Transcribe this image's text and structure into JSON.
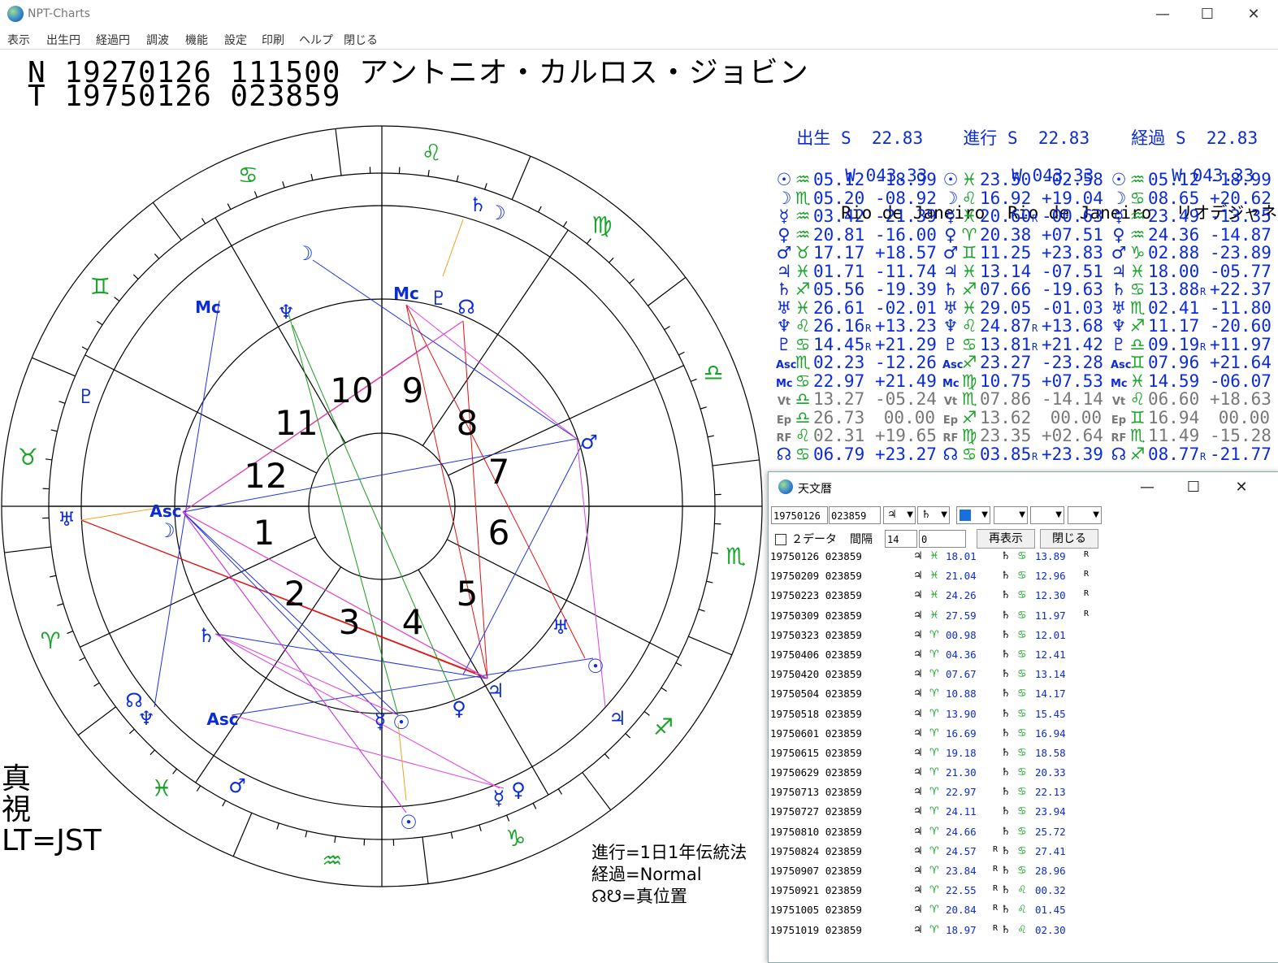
{
  "window": {
    "title": "NPT-Charts",
    "minimize": "—",
    "maximize": "☐",
    "close": "✕"
  },
  "menu": [
    "表示",
    "出生円",
    "経過円",
    "調波",
    "機能",
    "設定",
    "印刷",
    "ヘルプ",
    "閉じる"
  ],
  "header": {
    "line1": "N 19270126 111500 アントニオ・カルロス・ジョビン",
    "line2": "T 19750126 023859"
  },
  "chart": {
    "house_numbers": [
      "1",
      "2",
      "3",
      "4",
      "5",
      "6",
      "7",
      "8",
      "9",
      "10",
      "11",
      "12"
    ],
    "signs_outer": [
      "♌",
      "♋",
      "♊",
      "♉",
      "♈",
      "♓",
      "♒",
      "♑",
      "♐",
      "♏",
      "♎",
      "♍"
    ],
    "left_label": "真\n視\nLT=JST",
    "notes": "進行=1日1年伝統法\n経過=Normal\n☊☋=真位置"
  },
  "locations": [
    {
      "label": "出生",
      "lat": "S  22.83",
      "lon": "W 043.33",
      "city": "Rio de Janeiro"
    },
    {
      "label": "進行",
      "lat": "S  22.83",
      "lon": "W 043.33",
      "city": "Rio de Janeiro"
    },
    {
      "label": "経過",
      "lat": "S  22.83",
      "lon": "W 043.33",
      "city": "リオデジャネイ"
    }
  ],
  "positions": {
    "planet_glyphs": [
      "☉",
      "☽",
      "☿",
      "♀",
      "♂",
      "♃",
      "♄",
      "♅",
      "♆",
      "♇",
      "Asc",
      "Mc",
      "Vt",
      "Ep",
      "RF",
      "☊"
    ],
    "planet_colors": [
      "#0b2bd8",
      "#0b2bd8",
      "#0b2bd8",
      "#0b2bd8",
      "#0b2bd8",
      "#0b2bd8",
      "#0b2bd8",
      "#0b2bd8",
      "#0b2bd8",
      "#0b2bd8",
      "#0b2bd8",
      "#0b2bd8",
      "#777777",
      "#777777",
      "#777777",
      "#0b2bd8"
    ],
    "columns": [
      {
        "color": "#0b2bd8",
        "rows": [
          {
            "sign": "♒",
            "deg": "05.12",
            "r": "",
            "lat": "-18.99"
          },
          {
            "sign": "♏",
            "deg": "05.20",
            "r": "",
            "lat": "-08.92"
          },
          {
            "sign": "♒",
            "deg": "03.42",
            "r": "",
            "lat": "-21.39"
          },
          {
            "sign": "♒",
            "deg": "20.81",
            "r": "",
            "lat": "-16.00"
          },
          {
            "sign": "♉",
            "deg": "17.17",
            "r": "",
            "lat": "+18.57"
          },
          {
            "sign": "♓",
            "deg": "01.71",
            "r": "",
            "lat": "-11.74"
          },
          {
            "sign": "♐",
            "deg": "05.56",
            "r": "",
            "lat": "-19.39"
          },
          {
            "sign": "♓",
            "deg": "26.61",
            "r": "",
            "lat": "-02.01"
          },
          {
            "sign": "♌",
            "deg": "26.16",
            "r": "R",
            "lat": "+13.23"
          },
          {
            "sign": "♋",
            "deg": "14.45",
            "r": "R",
            "lat": "+21.29"
          },
          {
            "sign": "♏",
            "deg": "02.23",
            "r": "",
            "lat": "-12.26"
          },
          {
            "sign": "♋",
            "deg": "22.97",
            "r": "",
            "lat": "+21.49"
          },
          {
            "sign": "♎",
            "deg": "13.27",
            "r": "",
            "lat": "-05.24"
          },
          {
            "sign": "♎",
            "deg": "26.73",
            "r": "",
            "lat": "00.00"
          },
          {
            "sign": "♌",
            "deg": "02.31",
            "r": "",
            "lat": "+19.65"
          },
          {
            "sign": "♋",
            "deg": "06.79",
            "r": "",
            "lat": "+23.27"
          }
        ]
      },
      {
        "color": "#0b2bd8",
        "rows": [
          {
            "sign": "♓",
            "deg": "23.50",
            "r": "",
            "lat": "-02.58"
          },
          {
            "sign": "♌",
            "deg": "16.92",
            "r": "",
            "lat": "+19.04"
          },
          {
            "sign": "♓",
            "deg": "20.60",
            "r": "R",
            "lat": "-00.63"
          },
          {
            "sign": "♈",
            "deg": "20.38",
            "r": "",
            "lat": "+07.51"
          },
          {
            "sign": "♊",
            "deg": "11.25",
            "r": "",
            "lat": "+23.83"
          },
          {
            "sign": "♓",
            "deg": "13.14",
            "r": "",
            "lat": "-07.51"
          },
          {
            "sign": "♐",
            "deg": "07.66",
            "r": "",
            "lat": "-19.63"
          },
          {
            "sign": "♓",
            "deg": "29.05",
            "r": "",
            "lat": "-01.03"
          },
          {
            "sign": "♌",
            "deg": "24.87",
            "r": "R",
            "lat": "+13.68"
          },
          {
            "sign": "♋",
            "deg": "13.81",
            "r": "R",
            "lat": "+21.42"
          },
          {
            "sign": "♐",
            "deg": "23.27",
            "r": "",
            "lat": "-23.28"
          },
          {
            "sign": "♍",
            "deg": "10.75",
            "r": "",
            "lat": "+07.53"
          },
          {
            "sign": "♏",
            "deg": "07.86",
            "r": "",
            "lat": "-14.14"
          },
          {
            "sign": "♐",
            "deg": "13.62",
            "r": "",
            "lat": "00.00"
          },
          {
            "sign": "♍",
            "deg": "23.35",
            "r": "",
            "lat": "+02.64"
          },
          {
            "sign": "♋",
            "deg": "03.85",
            "r": "R",
            "lat": "+23.39"
          }
        ]
      },
      {
        "color": "#0b2bd8",
        "rows": [
          {
            "sign": "♒",
            "deg": "05.12",
            "r": "",
            "lat": "-18.99"
          },
          {
            "sign": "♋",
            "deg": "08.65",
            "r": "",
            "lat": "+20.62"
          },
          {
            "sign": "♒",
            "deg": "23.49",
            "r": "",
            "lat": "-13.35"
          },
          {
            "sign": "♒",
            "deg": "24.36",
            "r": "",
            "lat": "-14.87"
          },
          {
            "sign": "♑",
            "deg": "02.88",
            "r": "",
            "lat": "-23.89"
          },
          {
            "sign": "♓",
            "deg": "18.00",
            "r": "",
            "lat": "-05.77"
          },
          {
            "sign": "♋",
            "deg": "13.88",
            "r": "R",
            "lat": "+22.37"
          },
          {
            "sign": "♏",
            "deg": "02.41",
            "r": "",
            "lat": "-11.80"
          },
          {
            "sign": "♐",
            "deg": "11.17",
            "r": "",
            "lat": "-20.60"
          },
          {
            "sign": "♎",
            "deg": "09.19",
            "r": "R",
            "lat": "+11.97"
          },
          {
            "sign": "♊",
            "deg": "07.96",
            "r": "",
            "lat": "+21.64"
          },
          {
            "sign": "♓",
            "deg": "14.59",
            "r": "",
            "lat": "-06.07"
          },
          {
            "sign": "♌",
            "deg": "06.60",
            "r": "",
            "lat": "+18.63"
          },
          {
            "sign": "♊",
            "deg": "16.94",
            "r": "",
            "lat": "00.00"
          },
          {
            "sign": "♏",
            "deg": "11.49",
            "r": "",
            "lat": "-15.28"
          },
          {
            "sign": "♐",
            "deg": "08.77",
            "r": "R",
            "lat": "-21.77"
          }
        ]
      }
    ]
  },
  "ephemeris_window": {
    "title": "天文暦",
    "date": "19750126",
    "time": "023859",
    "planet1": "♃",
    "planet2": "♄",
    "two_data_label": "２データ",
    "interval_label": "間隔",
    "interval_value": "14",
    "interval_value2": "0",
    "redisplay_button": "再表示",
    "close_button": "閉じる",
    "rows": [
      {
        "date": "19750126",
        "time": "023859",
        "r1": "",
        "s1": "♓",
        "v1": "18.01",
        "r2": "",
        "s2": "♋",
        "v2": "13.89",
        "rr": "R"
      },
      {
        "date": "19750209",
        "time": "023859",
        "r1": "",
        "s1": "♓",
        "v1": "21.04",
        "r2": "",
        "s2": "♋",
        "v2": "12.96",
        "rr": "R"
      },
      {
        "date": "19750223",
        "time": "023859",
        "r1": "",
        "s1": "♓",
        "v1": "24.26",
        "r2": "",
        "s2": "♋",
        "v2": "12.30",
        "rr": "R"
      },
      {
        "date": "19750309",
        "time": "023859",
        "r1": "",
        "s1": "♓",
        "v1": "27.59",
        "r2": "",
        "s2": "♋",
        "v2": "11.97",
        "rr": "R"
      },
      {
        "date": "19750323",
        "time": "023859",
        "r1": "",
        "s1": "♈",
        "v1": "00.98",
        "r2": "",
        "s2": "♋",
        "v2": "12.01",
        "rr": ""
      },
      {
        "date": "19750406",
        "time": "023859",
        "r1": "",
        "s1": "♈",
        "v1": "04.36",
        "r2": "",
        "s2": "♋",
        "v2": "12.41",
        "rr": ""
      },
      {
        "date": "19750420",
        "time": "023859",
        "r1": "",
        "s1": "♈",
        "v1": "07.67",
        "r2": "",
        "s2": "♋",
        "v2": "13.14",
        "rr": ""
      },
      {
        "date": "19750504",
        "time": "023859",
        "r1": "",
        "s1": "♈",
        "v1": "10.88",
        "r2": "",
        "s2": "♋",
        "v2": "14.17",
        "rr": ""
      },
      {
        "date": "19750518",
        "time": "023859",
        "r1": "",
        "s1": "♈",
        "v1": "13.90",
        "r2": "",
        "s2": "♋",
        "v2": "15.45",
        "rr": ""
      },
      {
        "date": "19750601",
        "time": "023859",
        "r1": "",
        "s1": "♈",
        "v1": "16.69",
        "r2": "",
        "s2": "♋",
        "v2": "16.94",
        "rr": ""
      },
      {
        "date": "19750615",
        "time": "023859",
        "r1": "",
        "s1": "♈",
        "v1": "19.18",
        "r2": "",
        "s2": "♋",
        "v2": "18.58",
        "rr": ""
      },
      {
        "date": "19750629",
        "time": "023859",
        "r1": "",
        "s1": "♈",
        "v1": "21.30",
        "r2": "",
        "s2": "♋",
        "v2": "20.33",
        "rr": ""
      },
      {
        "date": "19750713",
        "time": "023859",
        "r1": "",
        "s1": "♈",
        "v1": "22.97",
        "r2": "",
        "s2": "♋",
        "v2": "22.13",
        "rr": ""
      },
      {
        "date": "19750727",
        "time": "023859",
        "r1": "",
        "s1": "♈",
        "v1": "24.11",
        "r2": "",
        "s2": "♋",
        "v2": "23.94",
        "rr": ""
      },
      {
        "date": "19750810",
        "time": "023859",
        "r1": "",
        "s1": "♈",
        "v1": "24.66",
        "r2": "",
        "s2": "♋",
        "v2": "25.72",
        "rr": ""
      },
      {
        "date": "19750824",
        "time": "023859",
        "r1": "",
        "s1": "♈",
        "v1": "24.57",
        "r2": "R",
        "s2": "♋",
        "v2": "27.41",
        "rr": ""
      },
      {
        "date": "19750907",
        "time": "023859",
        "r1": "",
        "s1": "♈",
        "v1": "23.84",
        "r2": "R",
        "s2": "♋",
        "v2": "28.96",
        "rr": ""
      },
      {
        "date": "19750921",
        "time": "023859",
        "r1": "",
        "s1": "♈",
        "v1": "22.55",
        "r2": "R",
        "s2": "♌",
        "v2": "00.32",
        "rr": ""
      },
      {
        "date": "19751005",
        "time": "023859",
        "r1": "",
        "s1": "♈",
        "v1": "20.84",
        "r2": "R",
        "s2": "♌",
        "v2": "01.45",
        "rr": ""
      },
      {
        "date": "19751019",
        "time": "023859",
        "r1": "",
        "s1": "♈",
        "v1": "18.97",
        "r2": "R",
        "s2": "♌",
        "v2": "02.30",
        "rr": ""
      }
    ]
  }
}
